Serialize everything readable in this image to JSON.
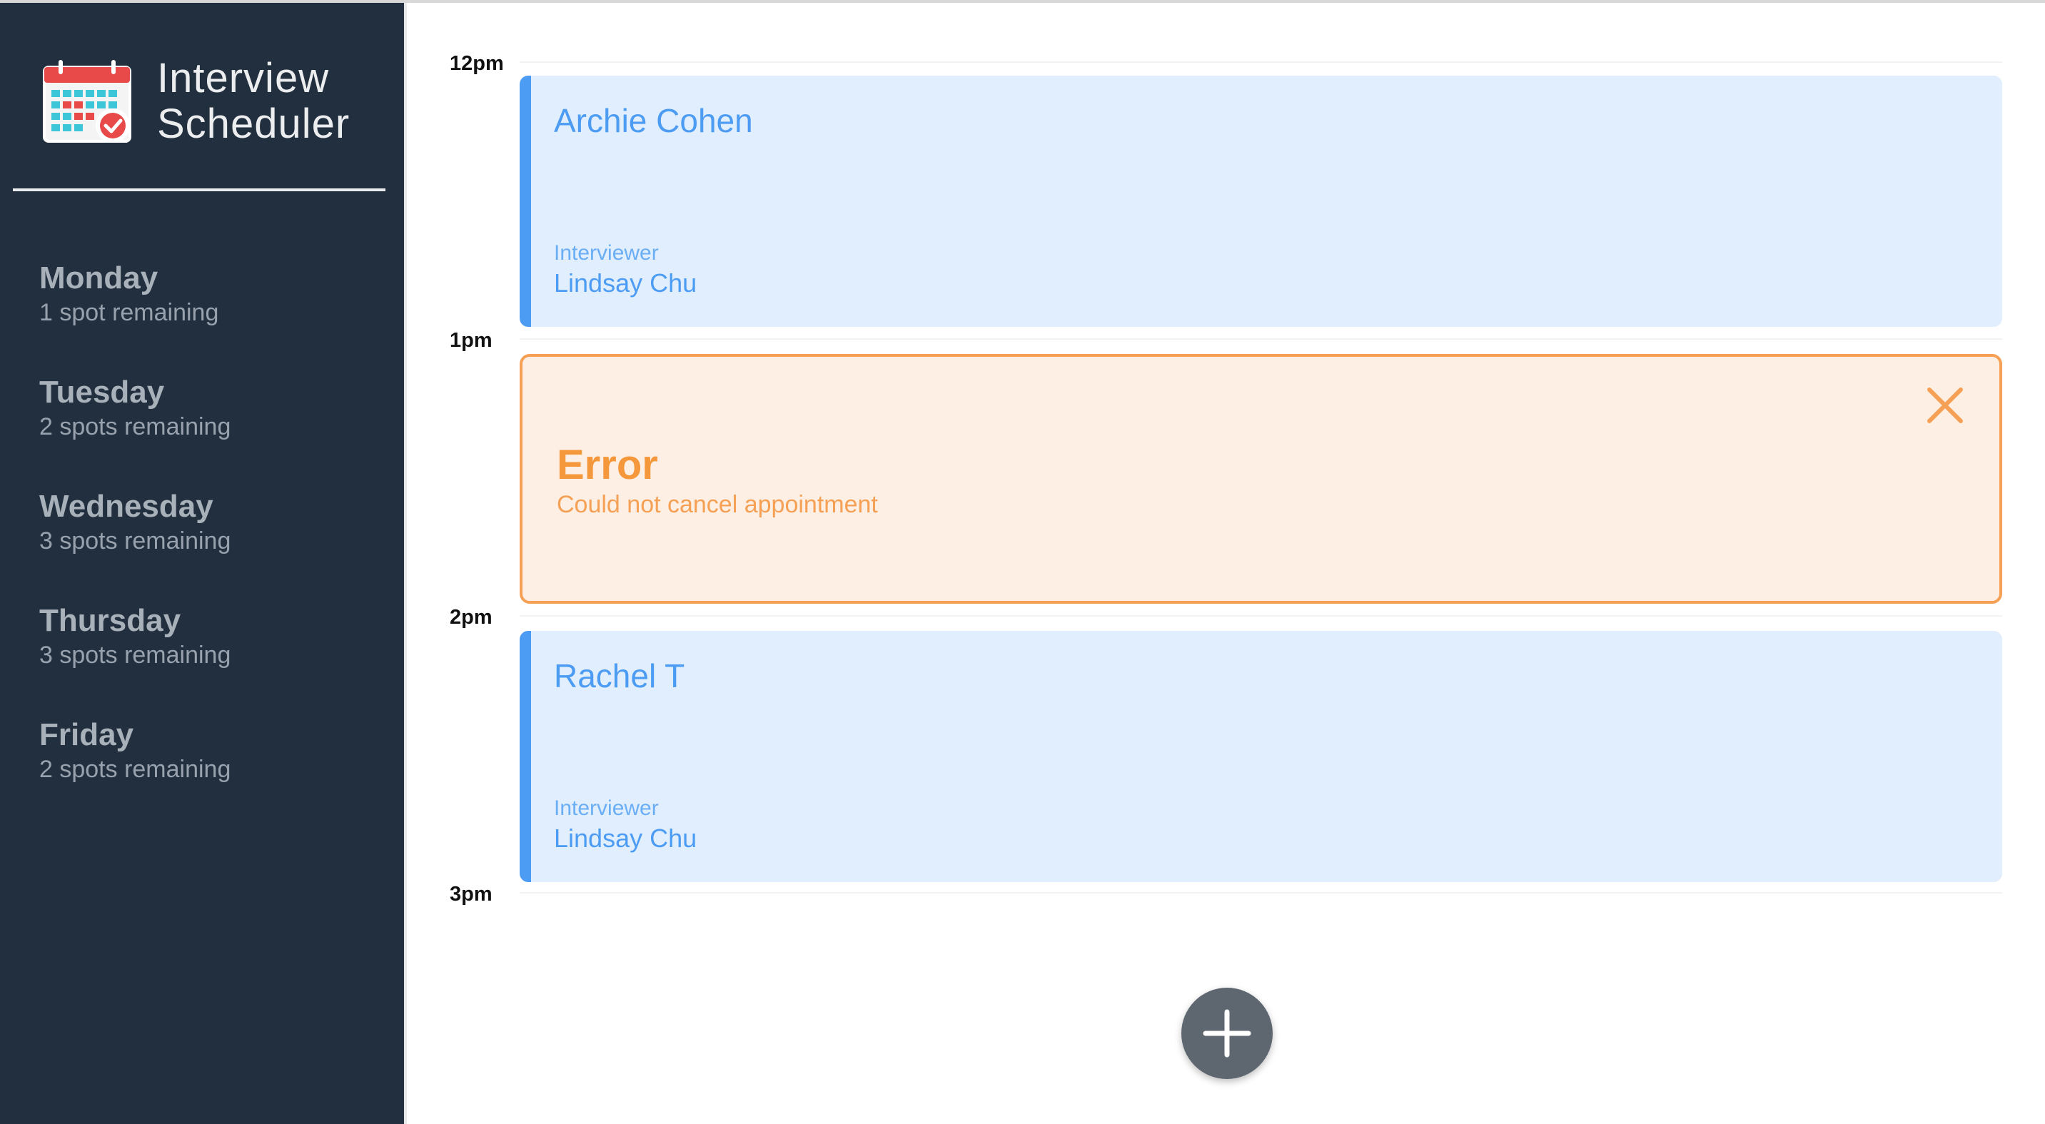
{
  "app": {
    "title_line1": "Interview",
    "title_line2": "Scheduler"
  },
  "sidebar": {
    "days": [
      {
        "name": "Monday",
        "spots": "1 spot remaining"
      },
      {
        "name": "Tuesday",
        "spots": "2 spots remaining"
      },
      {
        "name": "Wednesday",
        "spots": "3 spots remaining"
      },
      {
        "name": "Thursday",
        "spots": "3 spots remaining"
      },
      {
        "name": "Friday",
        "spots": "2 spots remaining"
      }
    ]
  },
  "schedule": {
    "times": [
      "12pm",
      "1pm",
      "2pm",
      "3pm"
    ],
    "appointments": [
      {
        "student": "Archie Cohen",
        "interviewer_label": "Interviewer",
        "interviewer": "Lindsay Chu"
      },
      {
        "student": "Rachel T",
        "interviewer_label": "Interviewer",
        "interviewer": "Lindsay Chu"
      }
    ],
    "error": {
      "title": "Error",
      "message": "Could not cancel appointment"
    }
  },
  "icons": {
    "logo": "calendar-check-icon",
    "close": "close-icon",
    "add": "plus-icon"
  },
  "colors": {
    "sidebar_bg": "#222f3e",
    "appointment_bg": "#e1eefd",
    "appointment_accent": "#4c9cf3",
    "error_bg": "#fdefe3",
    "error_accent": "#f5a054",
    "add_button": "#5e6670"
  }
}
